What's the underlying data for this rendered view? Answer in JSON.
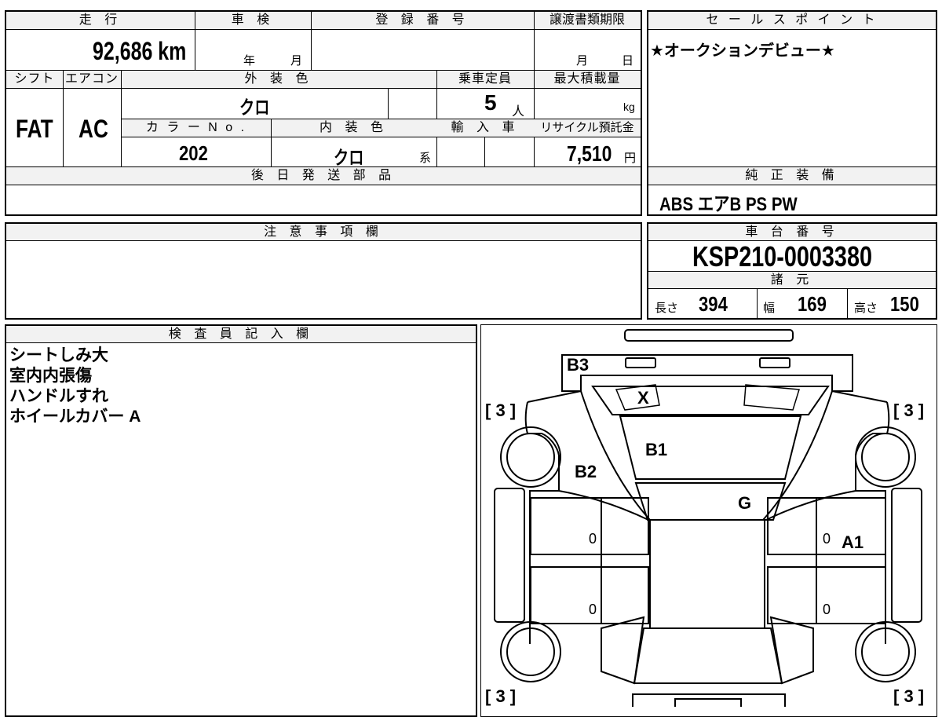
{
  "labels": {
    "mileage": "走 行",
    "inspection": "車 検",
    "registration_no": "登 録 番 号",
    "transfer_deadline": "譲渡書類期限",
    "shift": "シフト",
    "aircon": "エアコン",
    "exterior_color": "外 装 色",
    "capacity": "乗車定員",
    "max_load": "最大積載量",
    "color_no": "カ ラ ー N o .",
    "interior_color": "内 装 色",
    "import": "輸 入 車",
    "recycle_fee": "リサイクル預託金",
    "later_parts": "後 日 発 送 部 品",
    "sales_points": "セ ー ル ス ポ イ ン ト",
    "genuine_equipment": "純 正 装 備",
    "notes": "注 意 事 項 欄",
    "chassis_no": "車 台 番 号",
    "specs": "諸 元",
    "inspector_notes": "検 査 員 記 入 欄",
    "year_unit": "年",
    "month_unit": "月",
    "month_unit2": "月",
    "day_unit": "日",
    "person_unit": "人",
    "kg_unit": "kg",
    "yen_unit": "円",
    "kei_unit": "系",
    "length_label": "長さ",
    "width_label": "幅",
    "height_label": "高さ"
  },
  "values": {
    "mileage": "92,686 km",
    "shift": "FAT",
    "aircon": "AC",
    "exterior_color": "クロ",
    "capacity": "5",
    "color_no": "202",
    "interior_color": "クロ",
    "recycle_fee": "7,510",
    "sales_point_text": "★オークションデビュー★",
    "genuine_equipment": "ABS エアB PS PW",
    "chassis_no": "KSP210-0003380",
    "length": "394",
    "width": "169",
    "height": "150"
  },
  "inspector_notes": [
    "シートしみ大",
    "室内内張傷",
    "ハンドルすれ",
    "ホイールカバー A"
  ],
  "diagram_marks": {
    "b3": "B3",
    "x": "X",
    "b1": "B1",
    "b2": "B2",
    "g": "G",
    "a1": "A1",
    "zero": "0",
    "tire_fl": "[ 3 ]",
    "tire_fr": "[ 3 ]",
    "tire_rl": "[ 3 ]",
    "tire_rr": "[ 3 ]"
  }
}
